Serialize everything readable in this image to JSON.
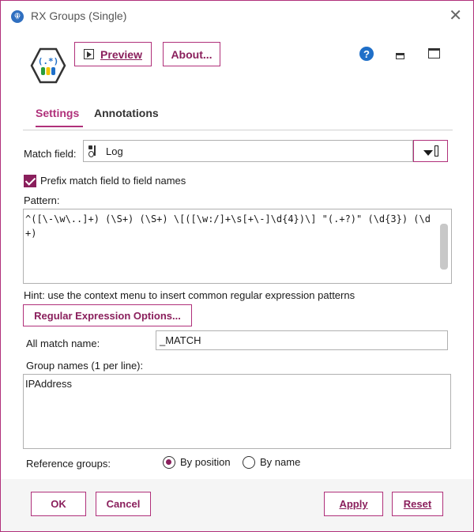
{
  "window": {
    "title": "RX Groups (Single)"
  },
  "toolbar": {
    "preview_label": "Preview",
    "about_label": "About..."
  },
  "tabs": [
    {
      "label": "Settings"
    },
    {
      "label": "Annotations"
    }
  ],
  "settings": {
    "match_field_label": "Match field:",
    "match_field_value": "Log",
    "prefix_label": "Prefix match field to field names",
    "prefix_checked": true,
    "pattern_label": "Pattern:",
    "pattern_value": "^([\\-\\w\\..]+) (\\S+) (\\S+) \\[([\\w:/]+\\s[+\\-]\\d{4})\\] \"(.+?)\" (\\d{3}) (\\d+)",
    "hint": "Hint: use the context menu to insert common regular expression patterns",
    "regex_options_label": "Regular Expression Options...",
    "all_match_label": "All match name:",
    "all_match_value": "_MATCH",
    "group_names_label": "Group names (1 per line):",
    "group_names_value": "IPAddress",
    "reference_groups_label": "Reference groups:",
    "by_position_label": "By position",
    "by_name_label": "By name",
    "reference_selected": "By position"
  },
  "footer": {
    "ok_label": "OK",
    "cancel_label": "Cancel",
    "apply_label": "Apply",
    "reset_label": "Reset"
  },
  "colors": {
    "accent": "#b0307a",
    "accent_dark": "#8a1f5c",
    "help_blue": "#1f6fc8"
  },
  "icons": [
    "app-diamond-icon",
    "close-icon",
    "regex-tool-icon",
    "play-icon",
    "help-icon",
    "minimize-icon",
    "maximize-icon",
    "field-type-icon",
    "dropdown-arrow-icon"
  ]
}
